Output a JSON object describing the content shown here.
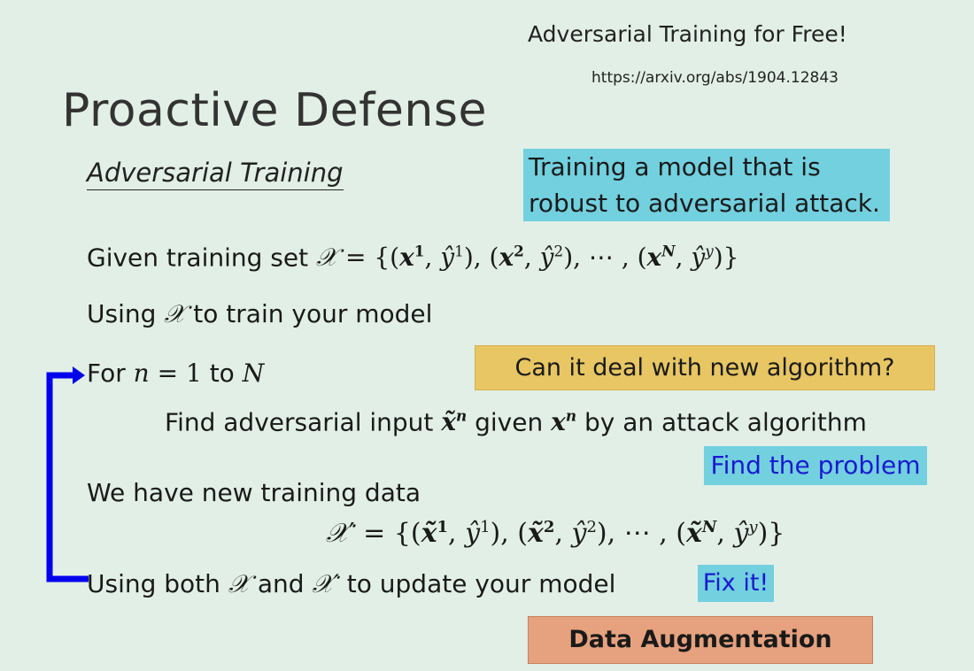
{
  "reference": {
    "title": "Adversarial Training for Free!",
    "url": "https://arxiv.org/abs/1904.12843"
  },
  "slide": {
    "title": "Proactive Defense",
    "subtitle": "Adversarial Training"
  },
  "notes": {
    "robust": "Training a model that is robust to adversarial attack.",
    "question": "Can it deal with new algorithm?",
    "find_problem": "Find the problem",
    "fix_it": "Fix it!",
    "data_augmentation": "Data Augmentation"
  },
  "lines": {
    "given_prefix": "Given training set",
    "using_prefix": "Using",
    "using_suffix": "to train your model",
    "for_prefix": "For",
    "for_to": "to",
    "find_prefix": "Find adversarial input",
    "find_given": "given",
    "find_suffix": "by an attack algorithm",
    "new_data": "We have new training data",
    "update_prefix": "Using both",
    "update_and": "and",
    "update_suffix": "to update your model"
  },
  "colors": {
    "background": "#e2efe6",
    "highlight_cyan": "#72d0df",
    "highlight_gold": "#e7c663",
    "highlight_orange": "#e6a27e",
    "loop_arrow": "#0000ee"
  }
}
